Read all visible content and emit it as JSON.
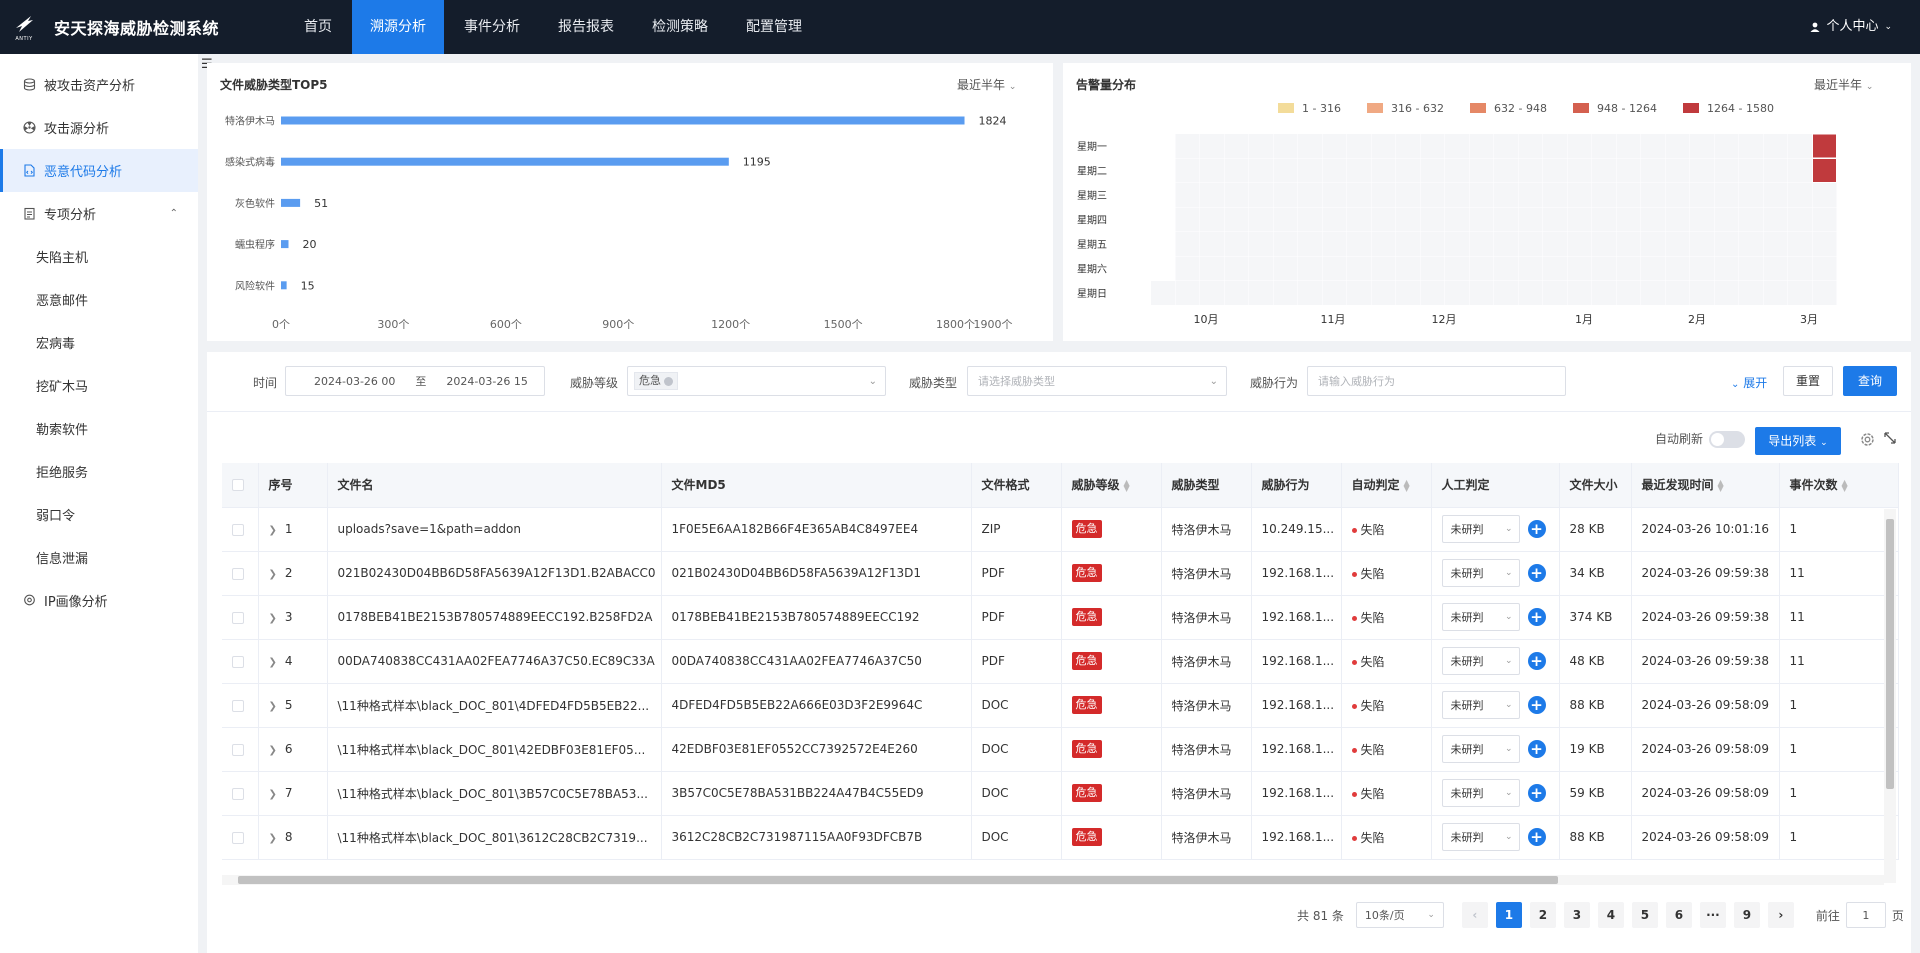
{
  "app": {
    "title": "安天探海威胁检测系统",
    "logo_sub": "ANTIY",
    "user_label": "个人中心"
  },
  "nav": [
    "首页",
    "溯源分析",
    "事件分析",
    "报告报表",
    "检测策略",
    "配置管理"
  ],
  "sidebar": {
    "items": [
      {
        "label": "被攻击资产分析",
        "icon": "database-icon"
      },
      {
        "label": "攻击源分析",
        "icon": "radiation-icon"
      },
      {
        "label": "恶意代码分析",
        "icon": "file-code-icon"
      },
      {
        "label": "专项分析",
        "icon": "clipboard-icon"
      },
      {
        "label": "IP画像分析",
        "icon": "location-pin-icon"
      }
    ],
    "subitems": [
      "失陷主机",
      "恶意邮件",
      "宏病毒",
      "挖矿木马",
      "勒索软件",
      "拒绝服务",
      "弱口令",
      "信息泄漏"
    ]
  },
  "bar_card": {
    "title": "文件威胁类型TOP5",
    "range_label": "最近半年"
  },
  "heat_card": {
    "title": "告警量分布",
    "range_label": "最近半年",
    "legend": [
      {
        "label": "1 - 316",
        "color": "#f3dc9a"
      },
      {
        "label": "316 - 632",
        "color": "#f0a983"
      },
      {
        "label": "632 - 948",
        "color": "#e58866"
      },
      {
        "label": "948 - 1264",
        "color": "#d4604f"
      },
      {
        "label": "1264 - 1580",
        "color": "#c03a3d"
      }
    ],
    "days": [
      "星期一",
      "星期二",
      "星期三",
      "星期四",
      "星期五",
      "星期六",
      "星期日"
    ],
    "months": [
      "10月",
      "11月",
      "12月",
      "1月",
      "2月",
      "3月"
    ]
  },
  "chart_data": [
    {
      "type": "bar",
      "orientation": "horizontal",
      "title": "文件威胁类型TOP5",
      "categories": [
        "特洛伊木马",
        "感染式病毒",
        "灰色软件",
        "蠕虫程序",
        "风险软件"
      ],
      "values": [
        1824,
        1195,
        51,
        20,
        15
      ],
      "xticks": [
        "0个",
        "300个",
        "600个",
        "900个",
        "1200个",
        "1500个",
        "1800个",
        "1900个"
      ],
      "xlim": [
        0,
        1900
      ],
      "color": "#5a9cf0"
    },
    {
      "type": "heatmap",
      "title": "告警量分布",
      "rows": [
        "星期一",
        "星期二",
        "星期三",
        "星期四",
        "星期五",
        "星期六",
        "星期日"
      ],
      "columns": [
        "10月",
        "11月",
        "12月",
        "1月",
        "2月",
        "3月"
      ],
      "cells": [
        {
          "row": "星期一",
          "bucket": "1264 - 1580"
        },
        {
          "row": "星期二",
          "bucket": "1264 - 1580"
        }
      ]
    }
  ],
  "filters": {
    "time_label": "时间",
    "time_start": "2024-03-26 00",
    "time_sep": "至",
    "time_end": "2024-03-26 15",
    "level_label": "威胁等级",
    "level_tag": "危急",
    "type_label": "威胁类型",
    "type_placeholder": "请选择威胁类型",
    "behavior_label": "威胁行为",
    "behavior_placeholder": "请输入威胁行为",
    "expand": "展开",
    "reset": "重置",
    "search": "查询"
  },
  "toolbar": {
    "auto_refresh": "自动刷新",
    "export": "导出列表"
  },
  "table": {
    "headers": [
      "序号",
      "文件名",
      "文件MD5",
      "文件格式",
      "威胁等级",
      "威胁类型",
      "威胁行为",
      "自动判定",
      "人工判定",
      "文件大小",
      "最近发现时间",
      "事件次数"
    ],
    "rows": [
      {
        "no": "1",
        "name": "uploads?save=1&path=addon",
        "md5": "1F0E5E6AA182B66F4E365AB4C8497EE4",
        "fmt": "ZIP",
        "level": "危急",
        "type": "特洛伊木马",
        "behavior": "10.249.15...",
        "auto": "失陷",
        "manual": "未研判",
        "size": "28 KB",
        "time": "2024-03-26 10:01:16",
        "count": "1"
      },
      {
        "no": "2",
        "name": "021B02430D04BB6D58FA5639A12F13D1.B2ABACC0",
        "md5": "021B02430D04BB6D58FA5639A12F13D1",
        "fmt": "PDF",
        "level": "危急",
        "type": "特洛伊木马",
        "behavior": "192.168.1...",
        "auto": "失陷",
        "manual": "未研判",
        "size": "34 KB",
        "time": "2024-03-26 09:59:38",
        "count": "11"
      },
      {
        "no": "3",
        "name": "0178BEB41BE2153B780574889EECC192.B258FD2A",
        "md5": "0178BEB41BE2153B780574889EECC192",
        "fmt": "PDF",
        "level": "危急",
        "type": "特洛伊木马",
        "behavior": "192.168.1...",
        "auto": "失陷",
        "manual": "未研判",
        "size": "374 KB",
        "time": "2024-03-26 09:59:38",
        "count": "11"
      },
      {
        "no": "4",
        "name": "00DA740838CC431AA02FEA7746A37C50.EC89C33A",
        "md5": "00DA740838CC431AA02FEA7746A37C50",
        "fmt": "PDF",
        "level": "危急",
        "type": "特洛伊木马",
        "behavior": "192.168.1...",
        "auto": "失陷",
        "manual": "未研判",
        "size": "48 KB",
        "time": "2024-03-26 09:59:38",
        "count": "11"
      },
      {
        "no": "5",
        "name": "\\11种格式样本\\black_DOC_801\\4DFED4FD5B5EB22...",
        "md5": "4DFED4FD5B5EB22A666E03D3F2E9964C",
        "fmt": "DOC",
        "level": "危急",
        "type": "特洛伊木马",
        "behavior": "192.168.1...",
        "auto": "失陷",
        "manual": "未研判",
        "size": "88 KB",
        "time": "2024-03-26 09:58:09",
        "count": "1"
      },
      {
        "no": "6",
        "name": "\\11种格式样本\\black_DOC_801\\42EDBF03E81EF05...",
        "md5": "42EDBF03E81EF0552CC7392572E4E260",
        "fmt": "DOC",
        "level": "危急",
        "type": "特洛伊木马",
        "behavior": "192.168.1...",
        "auto": "失陷",
        "manual": "未研判",
        "size": "19 KB",
        "time": "2024-03-26 09:58:09",
        "count": "1"
      },
      {
        "no": "7",
        "name": "\\11种格式样本\\black_DOC_801\\3B57C0C5E78BA53...",
        "md5": "3B57C0C5E78BA531BB224A47B4C55ED9",
        "fmt": "DOC",
        "level": "危急",
        "type": "特洛伊木马",
        "behavior": "192.168.1...",
        "auto": "失陷",
        "manual": "未研判",
        "size": "59 KB",
        "time": "2024-03-26 09:58:09",
        "count": "1"
      },
      {
        "no": "8",
        "name": "\\11种格式样本\\black_DOC_801\\3612C28CB2C7319...",
        "md5": "3612C28CB2C731987115AA0F93DFCB7B",
        "fmt": "DOC",
        "level": "危急",
        "type": "特洛伊木马",
        "behavior": "192.168.1...",
        "auto": "失陷",
        "manual": "未研判",
        "size": "88 KB",
        "time": "2024-03-26 09:58:09",
        "count": "1"
      }
    ]
  },
  "pagination": {
    "total": "共 81 条",
    "page_size": "10条/页",
    "pages": [
      "1",
      "2",
      "3",
      "4",
      "5",
      "6",
      "···",
      "9"
    ],
    "goto_prefix": "前往",
    "goto_value": "1",
    "goto_suffix": "页"
  }
}
